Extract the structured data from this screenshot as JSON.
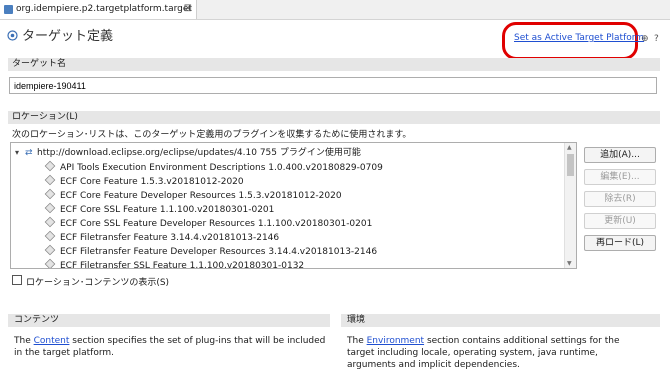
{
  "tab": {
    "title": "org.idempiere.p2.targetplatform.target",
    "close": "⊠"
  },
  "header": {
    "title": "ターゲット定義",
    "link": "Set as Active Target Platform",
    "icon_pin": "⊕",
    "icon_help": "?"
  },
  "name_section": {
    "label": "ターゲット名",
    "value": "idempiere-190411"
  },
  "locations": {
    "label": "ロケーション(L)",
    "description": "次のロケーション･リストは、このターゲット定義用のプラグインを収集するために使用されます。",
    "root": "http://download.eclipse.org/eclipse/updates/4.10 755 プラグイン使用可能",
    "items": [
      "API Tools Execution Environment Descriptions 1.0.400.v20180829-0709",
      "ECF Core Feature 1.5.3.v20181012-2020",
      "ECF Core Feature Developer Resources 1.5.3.v20181012-2020",
      "ECF Core SSL Feature 1.1.100.v20180301-0201",
      "ECF Core SSL Feature Developer Resources 1.1.100.v20180301-0201",
      "ECF Filetransfer Feature 3.14.4.v20181013-2146",
      "ECF Filetransfer Feature Developer Resources 3.14.4.v20181013-2146",
      "ECF Filetransfer SSL Feature 1.1.100.v20180301-0132"
    ],
    "buttons": {
      "add": "追加(A)...",
      "edit": "編集(E)...",
      "remove": "除去(R)",
      "update": "更新(U)",
      "reload": "再ロード(L)"
    },
    "show_contents": "ロケーション･コンテンツの表示(S)"
  },
  "contents_panel": {
    "title": "コンテンツ",
    "pre": "The ",
    "link": "Content",
    "post": " section specifies the set of plug-ins that will be included in the target platform."
  },
  "env_panel": {
    "title": "環境",
    "pre": "The ",
    "link": "Environment",
    "post": " section contains additional settings for the target including locale, operating system, java runtime, arguments and implicit dependencies."
  }
}
